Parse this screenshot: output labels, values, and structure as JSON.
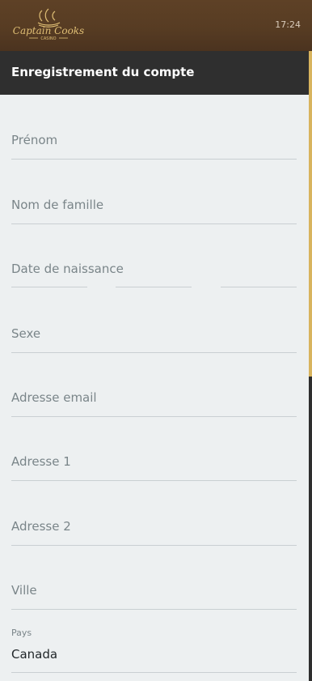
{
  "header": {
    "logo_text": "Captain Cooks",
    "logo_subtext": "CASINO",
    "time": "17:24"
  },
  "page": {
    "title": "Enregistrement du compte"
  },
  "form": {
    "first_name": {
      "placeholder": "Prénom"
    },
    "last_name": {
      "placeholder": "Nom de famille"
    },
    "birth_date": {
      "placeholder": "Date de naissance"
    },
    "gender": {
      "placeholder": "Sexe"
    },
    "email": {
      "placeholder": "Adresse email"
    },
    "address1": {
      "placeholder": "Adresse 1"
    },
    "address2": {
      "placeholder": "Adresse 2"
    },
    "city": {
      "placeholder": "Ville"
    },
    "country": {
      "label": "Pays",
      "value": "Canada"
    }
  },
  "colors": {
    "header_brown": "#573c23",
    "logo_gold": "#e0bf75",
    "titlebar": "#2f2f2f",
    "scroll_thumb": "#d8b45e",
    "form_background": "#edf0f1",
    "placeholder": "#7a8589"
  }
}
